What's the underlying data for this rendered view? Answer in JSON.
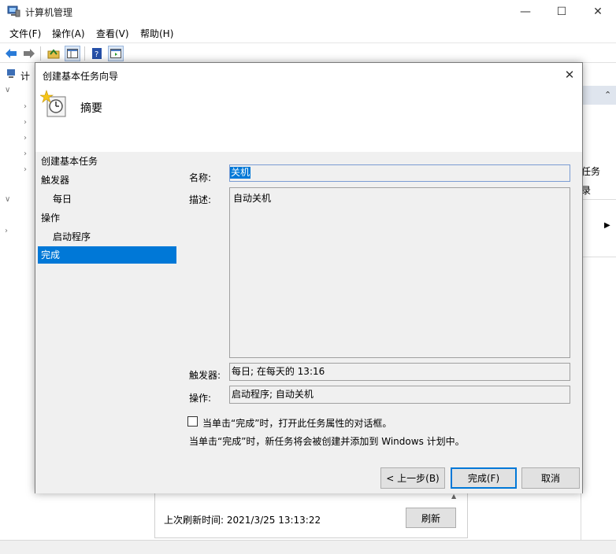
{
  "window": {
    "title": "计算机管理",
    "minimize_icon": "—",
    "maximize_icon": "☐",
    "close_icon": "✕"
  },
  "menu": [
    "文件(F)",
    "操作(A)",
    "查看(V)",
    "帮助(H)"
  ],
  "tree": {
    "root_label": "计"
  },
  "actions": {
    "line1": "任务",
    "line2": "录"
  },
  "bottom": {
    "refresh_time": "上次刷新时间: 2021/3/25 13:13:22",
    "refresh_button": "刷新"
  },
  "dialog": {
    "title": "创建基本任务向导",
    "heading": "摘要",
    "steps": [
      {
        "label": "创建基本任务",
        "sub": false,
        "active": false
      },
      {
        "label": "触发器",
        "sub": false,
        "active": false
      },
      {
        "label": "每日",
        "sub": true,
        "active": false
      },
      {
        "label": "操作",
        "sub": false,
        "active": false
      },
      {
        "label": "启动程序",
        "sub": true,
        "active": false
      },
      {
        "label": "完成",
        "sub": false,
        "active": true
      }
    ],
    "name_label": "名称:",
    "name_value": "关机",
    "desc_label": "描述:",
    "desc_value": "自动关机",
    "trigger_label": "触发器:",
    "trigger_value": "每日; 在每天的 13:16",
    "action_label": "操作:",
    "action_value": "启动程序; 自动关机",
    "checkbox_label": "当单击“完成”时，打开此任务属性的对话框。",
    "checkbox_checked": false,
    "info_text": "当单击“完成”时，新任务将会被创建并添加到 Windows 计划中。",
    "back_button": "< 上一步(B)",
    "finish_button": "完成(F)",
    "cancel_button": "取消"
  },
  "colors": {
    "accent": "#0078d7",
    "dialog_body": "#f0f0f0"
  }
}
